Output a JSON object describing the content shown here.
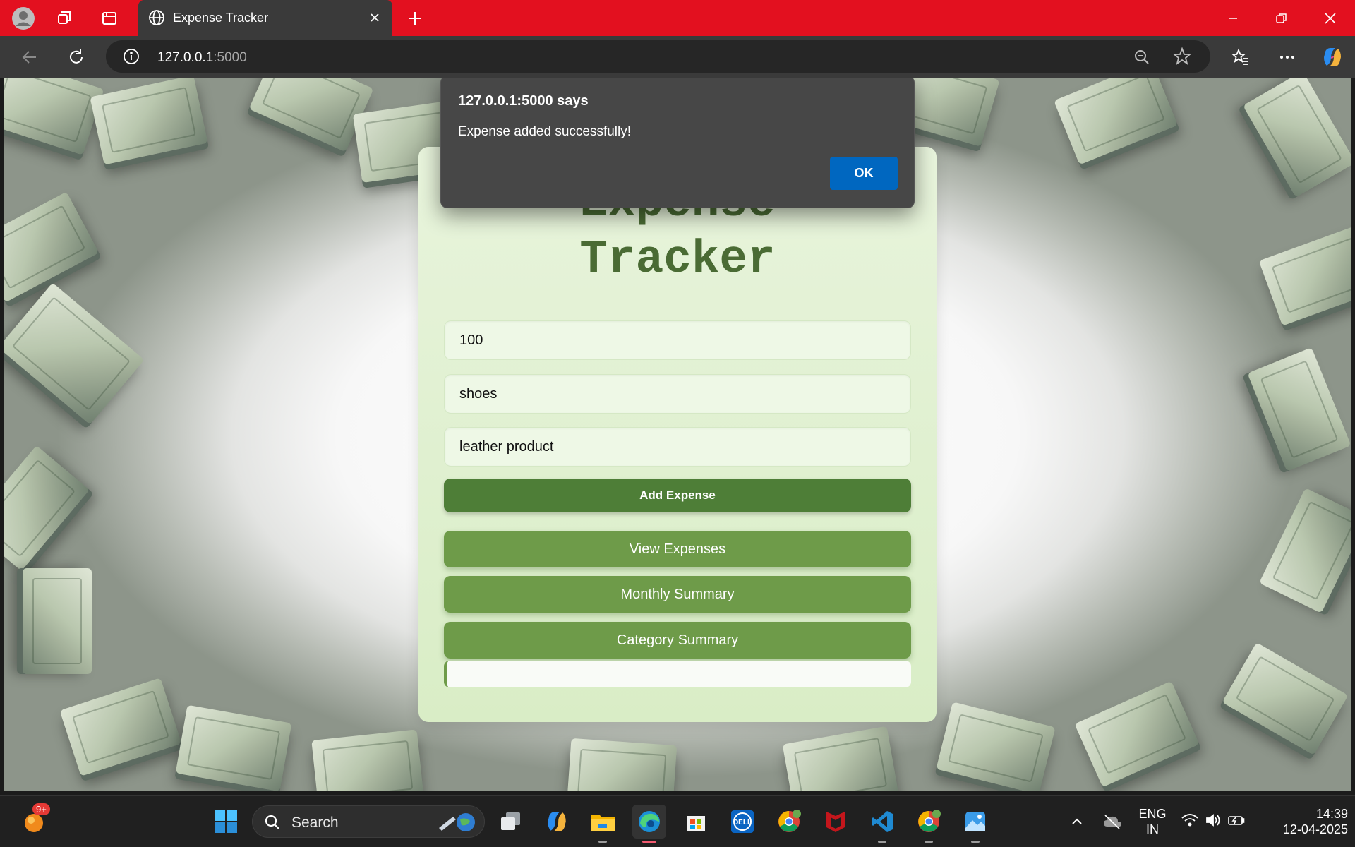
{
  "browser": {
    "tab_title": "Expense Tracker",
    "url_host": "127.0.0.1",
    "url_port": ":5000"
  },
  "app": {
    "title_line1": "Expense",
    "title_line2": "Tracker",
    "amount_value": "100",
    "category_value": "shoes",
    "description_value": "leather product",
    "add_button": "Add Expense",
    "view_button": "View Expenses",
    "monthly_button": "Monthly Summary",
    "category_button": "Category Summary"
  },
  "dialog": {
    "title": "127.0.0.1:5000 says",
    "message": "Expense added successfully!",
    "ok_label": "OK"
  },
  "taskbar": {
    "notification_badge": "9+",
    "search_label": "Search",
    "language_line1": "ENG",
    "language_line2": "IN",
    "time": "14:39",
    "date": "12-04-2025"
  },
  "colors": {
    "titlebar": "#e3101f",
    "card_title": "#4a6b34",
    "primary_button": "#4e7e37",
    "secondary_button": "#6e9b49",
    "dialog_ok": "#0067c0"
  }
}
